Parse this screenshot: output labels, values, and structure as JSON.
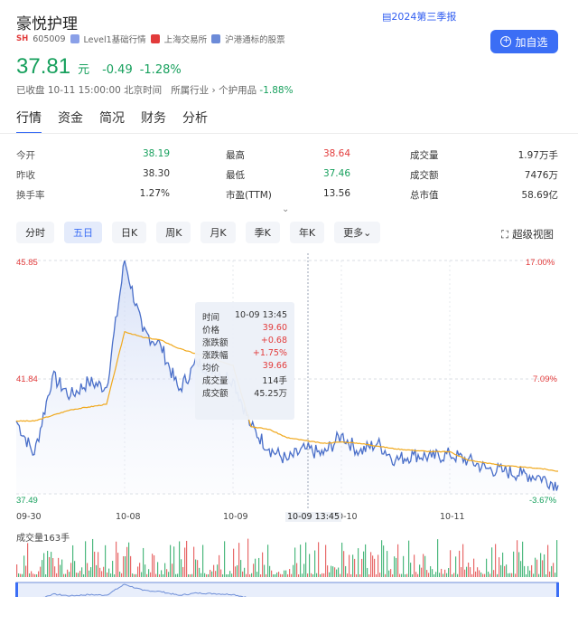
{
  "header": {
    "name": "豪悦护理",
    "exchange_tag": "SH",
    "code": "605009",
    "level_label": "Level1基础行情",
    "exchange_label": "上海交易所",
    "connect_label": "沪港通标的股票",
    "report_link": "2024第三季报",
    "add_button": "加自选"
  },
  "price": {
    "last": "37.81",
    "unit": "元",
    "change": "-0.49",
    "change_pct": "-1.28%"
  },
  "status": {
    "time": "已收盘 10-11 15:00:00 北京时间",
    "industry_label": "所属行业",
    "industry": "个护用品",
    "industry_chg": "-1.88%"
  },
  "tabs": [
    "行情",
    "资金",
    "简况",
    "财务",
    "分析"
  ],
  "quote": {
    "open_label": "今开",
    "open": "38.19",
    "high_label": "最高",
    "high": "38.64",
    "vol_label": "成交量",
    "vol": "1.97万手",
    "prev_label": "昨收",
    "prev": "38.30",
    "low_label": "最低",
    "low": "37.46",
    "amount_label": "成交额",
    "amount": "7476万",
    "turnover_label": "换手率",
    "turnover": "1.27%",
    "pe_label": "市盈(TTM)",
    "pe": "13.56",
    "mcap_label": "总市值",
    "mcap": "58.69亿"
  },
  "periods": [
    "分时",
    "五日",
    "日K",
    "周K",
    "月K",
    "季K",
    "年K",
    "更多"
  ],
  "big_view": "超级视图",
  "axis": {
    "y_top": "45.85",
    "y_mid": "41.84",
    "y_bottom": "37.49",
    "pct_top": "17.00%",
    "pct_mid": "7.09%",
    "pct_bottom": "-3.67%"
  },
  "x_labels": [
    "09-30",
    "10-08",
    "10-09",
    "10-10",
    "10-11"
  ],
  "crosshair_label": "10-09 13:45",
  "tooltip": {
    "time_label": "时间",
    "time": "10-09 13:45",
    "price_label": "价格",
    "price": "39.60",
    "chg_label": "涨跌额",
    "chg": "+0.68",
    "pct_label": "涨跌幅",
    "pct": "+1.75%",
    "avg_label": "均价",
    "avg": "39.66",
    "vol_label": "成交量",
    "vol": "114手",
    "amt_label": "成交额",
    "amt": "45.25万"
  },
  "volume_label": "成交量163手",
  "colors": {
    "up": "#e23b3b",
    "down": "#17a05d",
    "accent": "#3b6ef5",
    "line": "#4a6fc9",
    "avg": "#f0a81c"
  },
  "chart_data": {
    "type": "line",
    "ylim": [
      37.49,
      45.85
    ],
    "x": [
      "09-30",
      "10-08",
      "10-09",
      "10-10",
      "10-11"
    ],
    "series": [
      {
        "values": [
          40.1,
          38.9,
          41.7,
          41.0,
          41.5,
          41.3,
          45.85,
          43.3,
          42.8,
          41.2,
          42.2,
          41.9,
          41.6,
          39.9,
          39.1,
          38.7,
          39.1,
          38.9,
          39.6,
          39.0,
          39.3,
          38.7,
          38.9,
          38.8,
          38.9,
          38.7,
          38.4,
          38.3,
          38.2,
          38.1,
          37.8
        ]
      },
      {
        "values": [
          40.1,
          40.1,
          40.3,
          40.5,
          40.6,
          40.7,
          43.3,
          43.1,
          43.0,
          42.7,
          42.5,
          42.3,
          42.1,
          39.9,
          39.8,
          39.5,
          39.4,
          39.3,
          39.35,
          39.3,
          39.2,
          39.1,
          39.05,
          39.0,
          39.0,
          38.7,
          38.6,
          38.5,
          38.45,
          38.4,
          38.3
        ]
      }
    ]
  }
}
